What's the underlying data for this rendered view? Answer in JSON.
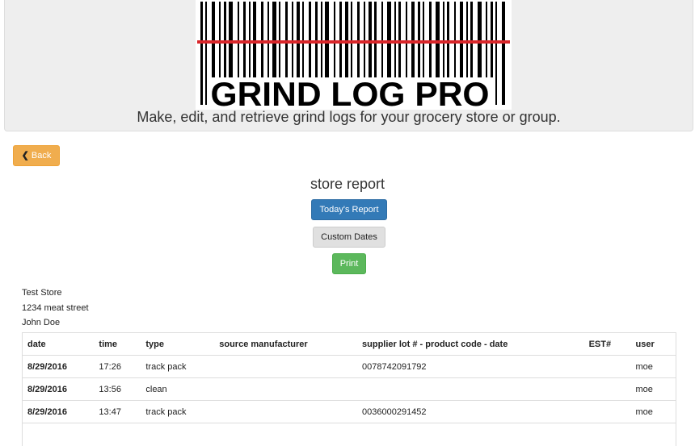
{
  "header": {
    "logo_text": "GRIND LOG PRO",
    "tagline": "Make, edit, and retrieve grind logs for your grocery store or group."
  },
  "nav": {
    "back_label": "Back",
    "back_icon": "chevron-left-icon"
  },
  "report": {
    "title": "store report",
    "today_label": "Today's Report",
    "custom_label": "Custom Dates",
    "print_label": "Print"
  },
  "store": {
    "name": "Test Store",
    "address": "1234 meat street",
    "contact": "John Doe"
  },
  "table": {
    "columns": [
      "date",
      "time",
      "type",
      "source manufacturer",
      "supplier lot # - product code - date",
      "EST#",
      "user"
    ],
    "rows": [
      [
        "8/29/2016",
        "17:26",
        "track pack",
        "",
        "0078742091792",
        "",
        "moe"
      ],
      [
        "8/29/2016",
        "13:56",
        "clean",
        "",
        "",
        "",
        "moe"
      ],
      [
        "8/29/2016",
        "13:47",
        "track pack",
        "",
        "0036000291452",
        "",
        "moe"
      ]
    ]
  },
  "colors": {
    "back": "#f0ad4e",
    "primary": "#337ab7",
    "success": "#5cb85c",
    "laser": "#d9262a"
  }
}
